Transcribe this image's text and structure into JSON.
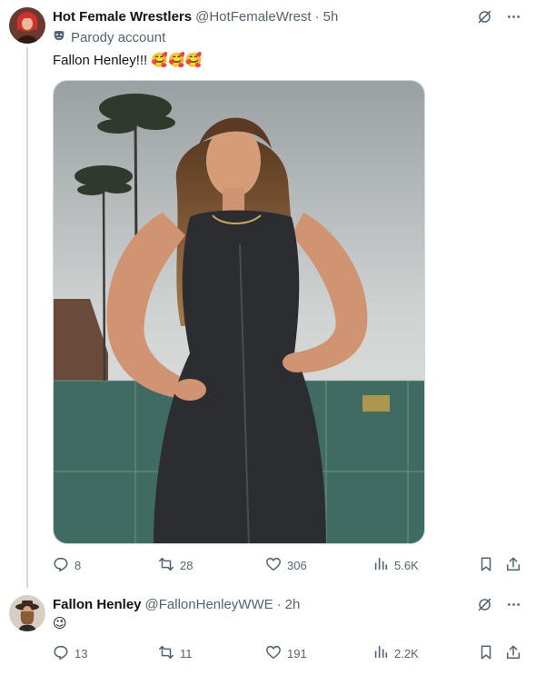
{
  "tweets": [
    {
      "author_name": "Hot Female Wrestlers",
      "handle": "@HotFemaleWrest",
      "time": "5h",
      "account_label": "Parody account",
      "text": "Fallon Henley!!! 🥰🥰🥰",
      "replies": "8",
      "reposts": "28",
      "likes": "306",
      "views": "5.6K"
    },
    {
      "author_name": "Fallon Henley",
      "handle": "@FallonHenleyWWE",
      "time": "2h",
      "text": "😉",
      "replies": "13",
      "reposts": "11",
      "likes": "191",
      "views": "2.2K"
    }
  ],
  "separator": "·",
  "icons": {
    "grok": "grok-icon",
    "more": "more-icon",
    "parody": "parody-mask-icon",
    "reply": "reply-icon",
    "repost": "repost-icon",
    "like": "like-icon",
    "views": "views-icon",
    "bookmark": "bookmark-icon",
    "share": "share-icon"
  },
  "colors": {
    "text_primary": "#0f1419",
    "text_secondary": "#536471",
    "border": "#cfd9de"
  }
}
